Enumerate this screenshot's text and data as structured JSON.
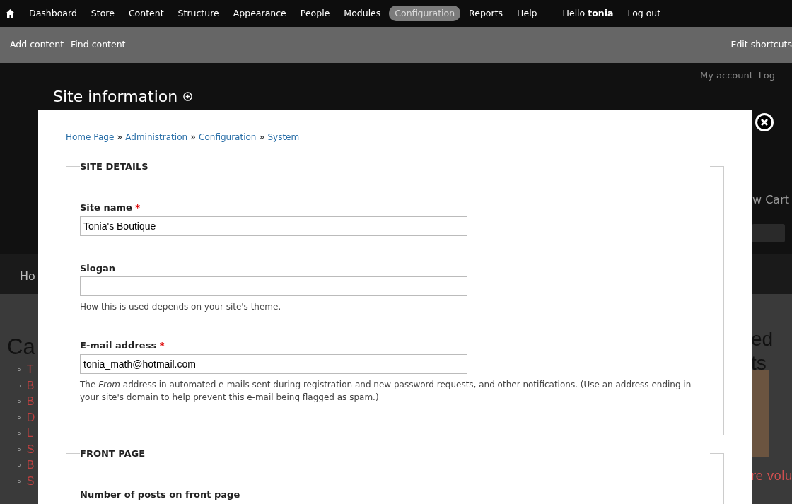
{
  "toolbar": {
    "items": [
      {
        "label": "Dashboard",
        "selected": false
      },
      {
        "label": "Store",
        "selected": false
      },
      {
        "label": "Content",
        "selected": false
      },
      {
        "label": "Structure",
        "selected": false
      },
      {
        "label": "Appearance",
        "selected": false
      },
      {
        "label": "People",
        "selected": false
      },
      {
        "label": "Modules",
        "selected": false
      },
      {
        "label": "Configuration",
        "selected": true
      },
      {
        "label": "Reports",
        "selected": false
      },
      {
        "label": "Help",
        "selected": false
      }
    ],
    "greeting": "Hello **tonia**",
    "logout": "Log out"
  },
  "shortcuts": {
    "items": [
      "Add content",
      "Find content"
    ],
    "edit": "Edit shortcuts"
  },
  "background": {
    "account_links": [
      "My account",
      "Log"
    ],
    "cart": "w Cart",
    "menu_item": "Ho",
    "heading": "Ca",
    "list_marker": "◦",
    "list": [
      "T",
      "B",
      "B",
      "D",
      "L",
      "S",
      "B",
      "S"
    ],
    "right_heading": [
      "ed",
      "ts"
    ],
    "right_link": "re volu"
  },
  "page_title": "Site information",
  "modal": {
    "breadcrumb": [
      "Home Page",
      "Administration",
      "Configuration",
      "System"
    ],
    "separator": "»",
    "fieldsets": [
      {
        "legend": "SITE DETAILS",
        "fields": [
          {
            "kind": "text",
            "label": "Site name",
            "required_mark": "*",
            "value": "Tonia's Boutique"
          },
          {
            "kind": "text",
            "label": "Slogan",
            "description": "How this is used depends on your site's theme."
          },
          {
            "kind": "text",
            "label": "E-mail address",
            "required_mark": "*",
            "value": "tonia_math@hotmail.com",
            "description": "The *From* address in automated e-mails sent during registration and new password requests, and other notifications. (Use an address ending in your site's domain to help prevent this e-mail being flagged as spam.)"
          }
        ]
      },
      {
        "legend": "FRONT PAGE",
        "fields": [
          {
            "kind": "heading",
            "label": "Number of posts on front page"
          }
        ]
      }
    ]
  }
}
